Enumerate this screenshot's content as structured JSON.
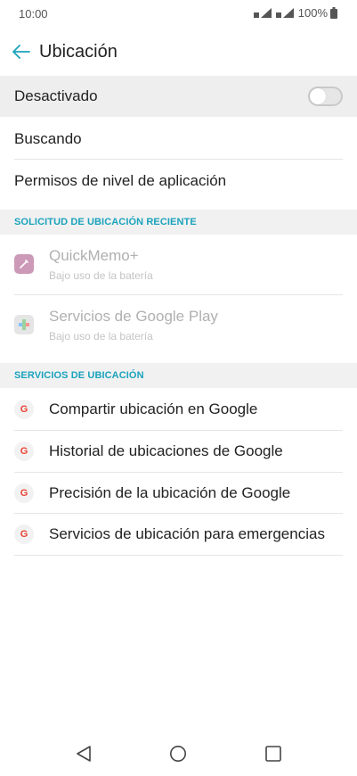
{
  "status_bar": {
    "time": "10:00",
    "battery": "100%"
  },
  "header": {
    "title": "Ubicación"
  },
  "location_toggle": {
    "label": "Desactivado",
    "on": false
  },
  "rows": [
    {
      "label": "Buscando"
    },
    {
      "label": "Permisos de nivel de aplicación"
    }
  ],
  "recent_section": {
    "header": "SOLICITUD DE UBICACIÓN RECIENTE",
    "items": [
      {
        "title": "QuickMemo+",
        "subtitle": "Bajo uso de la batería",
        "icon": "quickmemo-icon"
      },
      {
        "title": "Servicios de Google Play",
        "subtitle": "Bajo uso de la batería",
        "icon": "google-play-services-icon"
      }
    ]
  },
  "services_section": {
    "header": "SERVICIOS DE UBICACIÓN",
    "items": [
      {
        "label": "Compartir ubicación en Google",
        "icon": "google-icon"
      },
      {
        "label": "Historial de ubicaciones de Google",
        "icon": "google-icon"
      },
      {
        "label": "Precisión de la ubicación de Google",
        "icon": "google-icon"
      },
      {
        "label": "Servicios de ubicación para emergencias",
        "icon": "google-icon"
      }
    ]
  },
  "colors": {
    "accent": "#1aa3bd",
    "header_bg": "#f1f1f1",
    "toggle_row_bg": "#eeeeee"
  }
}
